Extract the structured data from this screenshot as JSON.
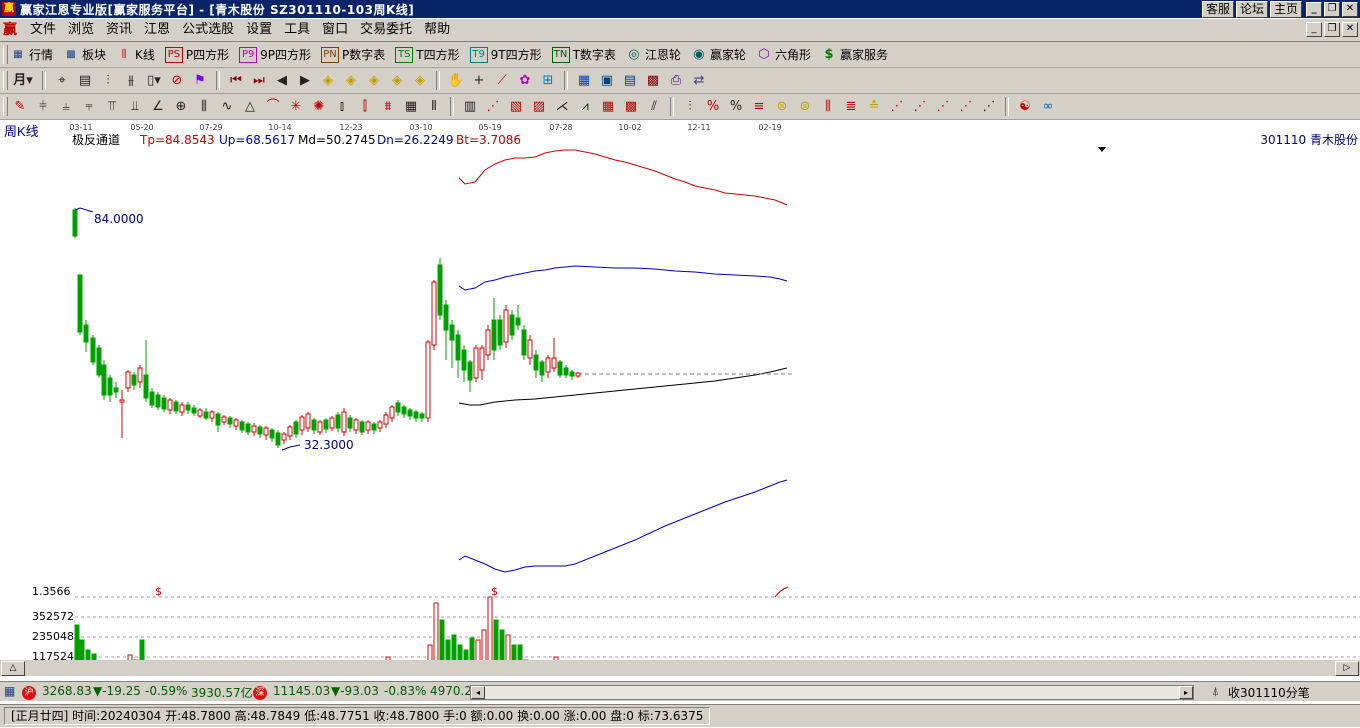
{
  "window": {
    "title": "赢家江恩专业版[赢家服务平台] - [青木股份   SZ301110-103周K线]",
    "top_links": [
      "客服",
      "论坛",
      "主页"
    ],
    "app_icon": "赢"
  },
  "menu": {
    "icon": "赢",
    "items": [
      "文件",
      "浏览",
      "资讯",
      "江恩",
      "公式选股",
      "设置",
      "工具",
      "窗口",
      "交易委托",
      "帮助"
    ]
  },
  "nav_toolbar": [
    {
      "icon": "▦",
      "label": "行情"
    },
    {
      "icon": "▩",
      "label": "板块"
    },
    {
      "icon": "⫼",
      "label": "K线"
    },
    {
      "icon": "PS",
      "label": "P四方形"
    },
    {
      "icon": "P9",
      "label": "9P四方形"
    },
    {
      "icon": "PN",
      "label": "P数字表"
    },
    {
      "icon": "TS",
      "label": "T四方形"
    },
    {
      "icon": "T9",
      "label": "9T四方形"
    },
    {
      "icon": "TN",
      "label": "T数字表"
    },
    {
      "icon": "◎",
      "label": "江恩轮"
    },
    {
      "icon": "◉",
      "label": "赢家轮"
    },
    {
      "icon": "⬡",
      "label": "六角形"
    },
    {
      "icon": "$",
      "label": "赢家服务"
    }
  ],
  "period_selector": {
    "value": "月"
  },
  "chart": {
    "period_label": "周K线",
    "indicator": {
      "name": "极反通道",
      "tp_label": "Tp=84.8543",
      "up_label": "Up=68.5617",
      "md_label": "Md=50.2745",
      "dn_label": "Dn=26.2249",
      "bt_label": "Bt=3.7086"
    },
    "stock_label": "301110  青木股份",
    "high_label": "84.0000",
    "low_label": "32.3000",
    "date_ticks": [
      "03-11",
      "05-20",
      "07-29",
      "10-14",
      "12-23",
      "03-10",
      "05-19",
      "07-28",
      "10-02",
      "12-11",
      "02-19"
    ],
    "volume_axis": [
      "1.3566",
      "352572",
      "235048",
      "117524"
    ],
    "dollar_marker": "$",
    "colors": {
      "up": "#e00000",
      "down": "#00a000",
      "tp_line": "#d00000",
      "up_line": "#0000c0",
      "md_line": "#000000",
      "label": "#000080"
    }
  },
  "status": {
    "sh_badge": "沪",
    "sh_index": "3268.83",
    "sh_change": "▼-19.25",
    "sh_pct": "-0.59%",
    "sh_amount": "3930.57亿",
    "sz_badge": "深",
    "sz_index": "11145.03",
    "sz_change": "▼-93.03",
    "sz_pct": "-0.83%",
    "sz_amount": "4970.2",
    "right_text": "收301110分笔"
  },
  "info_bar": {
    "text": "[正月廿四] 时间:20240304 开:48.7800 高:48.7849 低:48.7751 收:48.7800 手:0 额:0.00 换:0.00 涨:0.00 盘:0 标:73.6375"
  }
}
